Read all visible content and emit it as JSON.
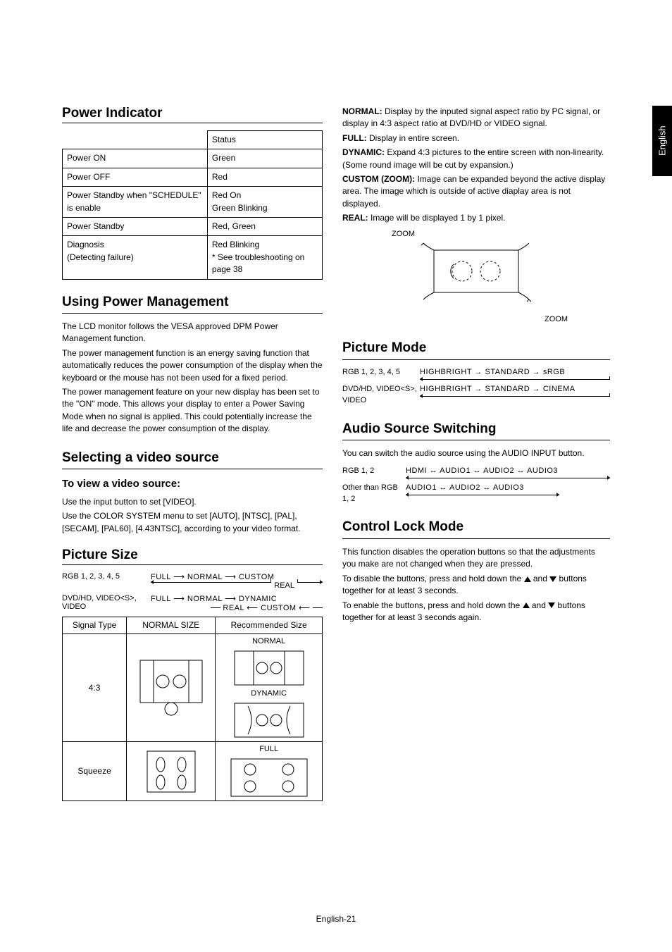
{
  "side_tab": "English",
  "footer": "English-21",
  "left": {
    "power_indicator": {
      "title": "Power Indicator",
      "header_status": "Status",
      "rows": [
        {
          "mode": "Power ON",
          "status": "Green"
        },
        {
          "mode": "Power OFF",
          "status": "Red"
        },
        {
          "mode": "Power Standby when \"SCHEDULE\" is enable",
          "status": "Red On\nGreen Blinking"
        },
        {
          "mode": "Power Standby",
          "status": "Red, Green"
        },
        {
          "mode": "Diagnosis\n(Detecting failure)",
          "status": "Red Blinking\n* See troubleshooting on page 38"
        }
      ]
    },
    "power_mgmt": {
      "title": "Using Power Management",
      "p1": "The LCD monitor follows the VESA approved DPM Power Management function.",
      "p2": "The power management function is an energy saving function that automatically reduces the power consumption of the display when the keyboard or the mouse has not been used for a fixed period.",
      "p3": "The power management feature on your new display has been set to the \"ON\" mode. This allows your display to enter a Power Saving Mode when no signal is applied. This could potentially increase the life and decrease the power consumption of the display."
    },
    "video_source": {
      "title": "Selecting a video source",
      "subtitle": "To view a video source:",
      "p1": "Use the input button to set [VIDEO].",
      "p2": "Use the COLOR SYSTEM menu to set [AUTO], [NTSC], [PAL], [SECAM], [PAL60], [4.43NTSC], according to your video format."
    },
    "picture_size": {
      "title": "Picture Size",
      "row1_label": "RGB 1, 2, 3, 4, 5",
      "row1_flow": {
        "a": "FULL",
        "b": "NORMAL",
        "c": "CUSTOM",
        "d": "REAL"
      },
      "row2_label": "DVD/HD, VIDEO<S>, VIDEO",
      "row2_flow": {
        "a": "FULL",
        "b": "NORMAL",
        "c": "DYNAMIC",
        "d": "REAL",
        "e": "CUSTOM"
      },
      "table": {
        "h1": "Signal Type",
        "h2": "NORMAL SIZE",
        "h3": "Recommended Size",
        "r1_type": "4:3",
        "r1_rec_a": "NORMAL",
        "r1_rec_b": "DYNAMIC",
        "r2_type": "Squeeze",
        "r2_rec": "FULL"
      }
    }
  },
  "right": {
    "definitions": {
      "normal_lbl": "NORMAL:",
      "normal_txt": " Display by the inputed signal aspect ratio by PC signal, or display in 4:3 aspect ratio at DVD/HD or VIDEO signal.",
      "full_lbl": "FULL:",
      "full_txt": " Display in entire screen.",
      "dynamic_lbl": "DYNAMIC:",
      "dynamic_txt": "  Expand 4:3 pictures to the entire screen with non-linearity. (Some round image will be cut by expansion.)",
      "custom_lbl": "CUSTOM (ZOOM):",
      "custom_txt": " Image can be expanded beyond the active display area. The image which is outside of active diaplay area is not displayed.",
      "real_lbl": "REAL:",
      "real_txt": " Image will be displayed 1 by 1 pixel.",
      "zoom_label": "ZOOM"
    },
    "picture_mode": {
      "title": "Picture Mode",
      "row1_label": "RGB 1, 2, 3, 4, 5",
      "row1_flow": {
        "a": "HIGHBRIGHT",
        "b": "STANDARD",
        "c": "sRGB"
      },
      "row2_label": "DVD/HD, VIDEO<S>, VIDEO",
      "row2_flow": {
        "a": "HIGHBRIGHT",
        "b": "STANDARD",
        "c": "CINEMA"
      }
    },
    "audio": {
      "title": "Audio Source Switching",
      "p1": "You can switch the audio source using the AUDIO INPUT button.",
      "row1_label": "RGB 1, 2",
      "row1_flow": {
        "a": "HDMI",
        "b": "AUDIO1",
        "c": "AUDIO2",
        "d": "AUDIO3"
      },
      "row2_label": "Other than RGB 1, 2",
      "row2_flow": {
        "a": "AUDIO1",
        "b": "AUDIO2",
        "c": "AUDIO3"
      }
    },
    "control_lock": {
      "title": "Control Lock Mode",
      "p1": "This function disables the operation buttons so that the adjustments you make are not changed when they are pressed.",
      "p2a": "To disable the buttons, press and hold down the ",
      "p2b": " and ",
      "p2c": " buttons together for at least 3 seconds.",
      "p3a": "To enable the buttons, press and hold down the ",
      "p3b": " and ",
      "p3c": " buttons together for at least 3 seconds again."
    }
  }
}
